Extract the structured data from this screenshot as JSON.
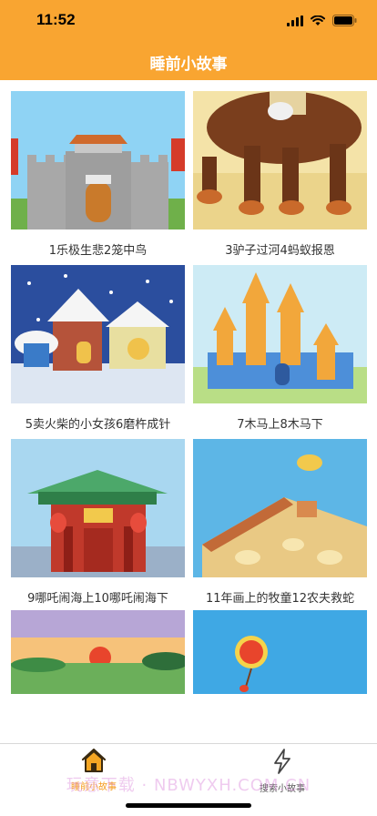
{
  "status_bar": {
    "time": "11:52",
    "icons": [
      "signal-icon",
      "wifi-icon",
      "battery-icon"
    ]
  },
  "nav": {
    "title": "睡前小故事"
  },
  "stories": [
    {
      "caption": "1乐极生悲2笼中鸟"
    },
    {
      "caption": "3驴子过河4蚂蚁报恩"
    },
    {
      "caption": "5卖火柴的小女孩6磨杵成针"
    },
    {
      "caption": "7木马上8木马下"
    },
    {
      "caption": "9哪吒闹海上10哪吒闹海下"
    },
    {
      "caption": "11年画上的牧童12农夫救蛇"
    },
    {
      "caption": ""
    },
    {
      "caption": ""
    }
  ],
  "tabbar": {
    "home": {
      "label": "睡前小故事",
      "icon": "home-icon"
    },
    "search": {
      "label": "搜索小故事",
      "icon": "lightning-icon"
    }
  },
  "watermark": "玩意下载 · NBWYXH.COM.CN",
  "colors": {
    "accent": "#F9A531",
    "tab_active": "#F59B1C",
    "title_text": "#ffffff"
  }
}
